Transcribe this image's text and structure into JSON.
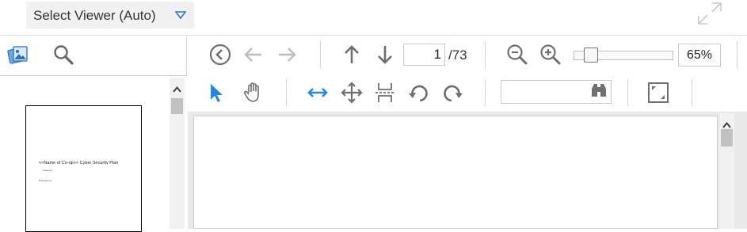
{
  "header": {
    "viewer_select_label": "Select Viewer (Auto)"
  },
  "sidebar": {
    "thumbnail": {
      "title": "<<Name of Co-op>> Cyber Security Plan",
      "line1": "Category",
      "line2": "Prepared by"
    }
  },
  "toolbar": {
    "current_page": "1",
    "page_total": "/73",
    "zoom_value": "65%",
    "zoom_fraction": 0.1,
    "search_placeholder": ""
  },
  "colors": {
    "accent_blue": "#2f86d6",
    "icon_gray": "#6f6f6f",
    "disabled_gray": "#b9b9b9"
  }
}
